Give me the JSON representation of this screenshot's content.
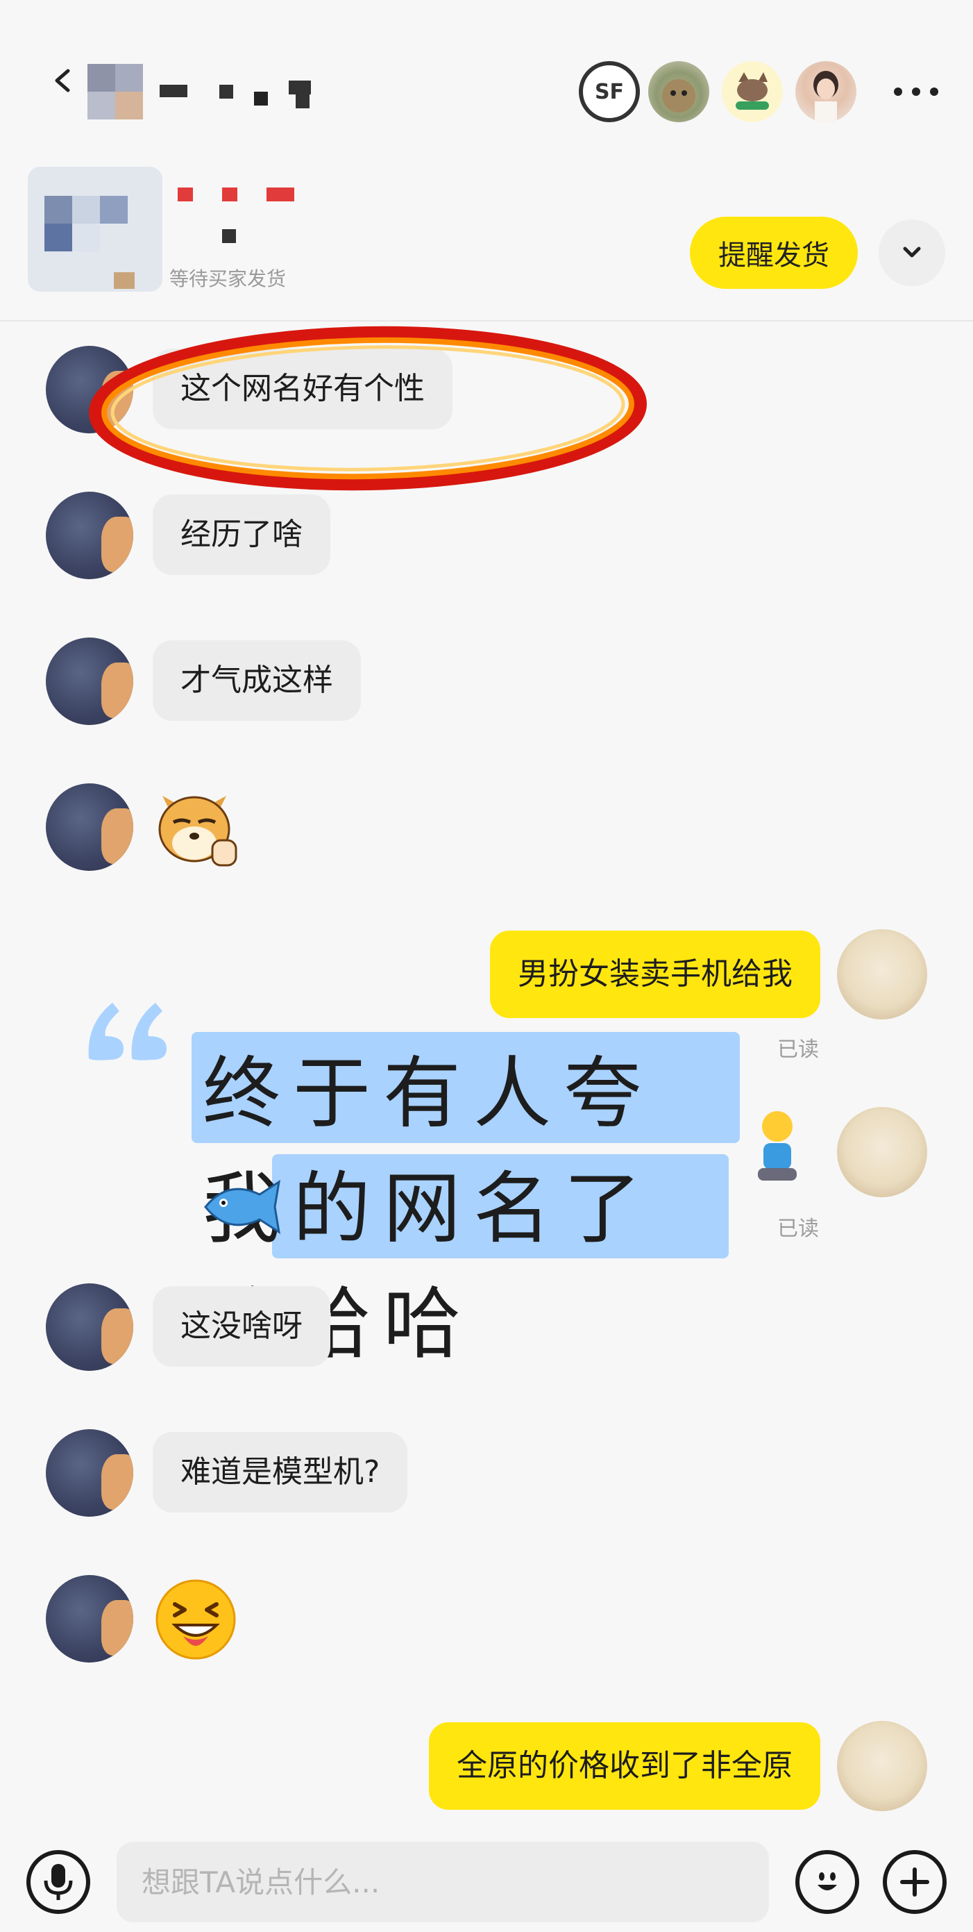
{
  "header": {
    "back_icon": "chevron-left-icon",
    "more_icon": "more-horizontal-icon",
    "sf_logo_text": "SF"
  },
  "order": {
    "status": "等待买家发货",
    "remind_button": "提醒发货",
    "expand_icon": "chevron-down-icon"
  },
  "messages": [
    {
      "side": "left",
      "type": "text",
      "text": "这个网名好有个性"
    },
    {
      "side": "left",
      "type": "text",
      "text": "经历了啥"
    },
    {
      "side": "left",
      "type": "text",
      "text": "才气成这样"
    },
    {
      "side": "left",
      "type": "sticker",
      "icon": "shiba-thumbs-up-emoji"
    },
    {
      "side": "right",
      "type": "text",
      "text": "男扮女装卖手机给我",
      "read": "已读"
    },
    {
      "side": "right",
      "type": "sticker",
      "text": "终于有人夸我的网名了哈哈哈",
      "read": "已读"
    },
    {
      "side": "left",
      "type": "text",
      "text": "这没啥呀"
    },
    {
      "side": "left",
      "type": "text",
      "text": "难道是模型机?"
    },
    {
      "side": "left",
      "type": "sticker",
      "icon": "laughing-face-emoji"
    },
    {
      "side": "right",
      "type": "text",
      "text": "全原的价格收到了非全原"
    }
  ],
  "input": {
    "placeholder": "想跟TA说点什么...",
    "mic_icon": "microphone-icon",
    "emoji_icon": "smiley-icon",
    "plus_icon": "plus-icon"
  },
  "colors": {
    "accent_yellow": "#ffe60f",
    "bubble_gray": "#ececec",
    "highlight_red": "#d7170f",
    "highlight_orange": "#ff8a00",
    "sticker_blue": "#a9d2ff"
  }
}
